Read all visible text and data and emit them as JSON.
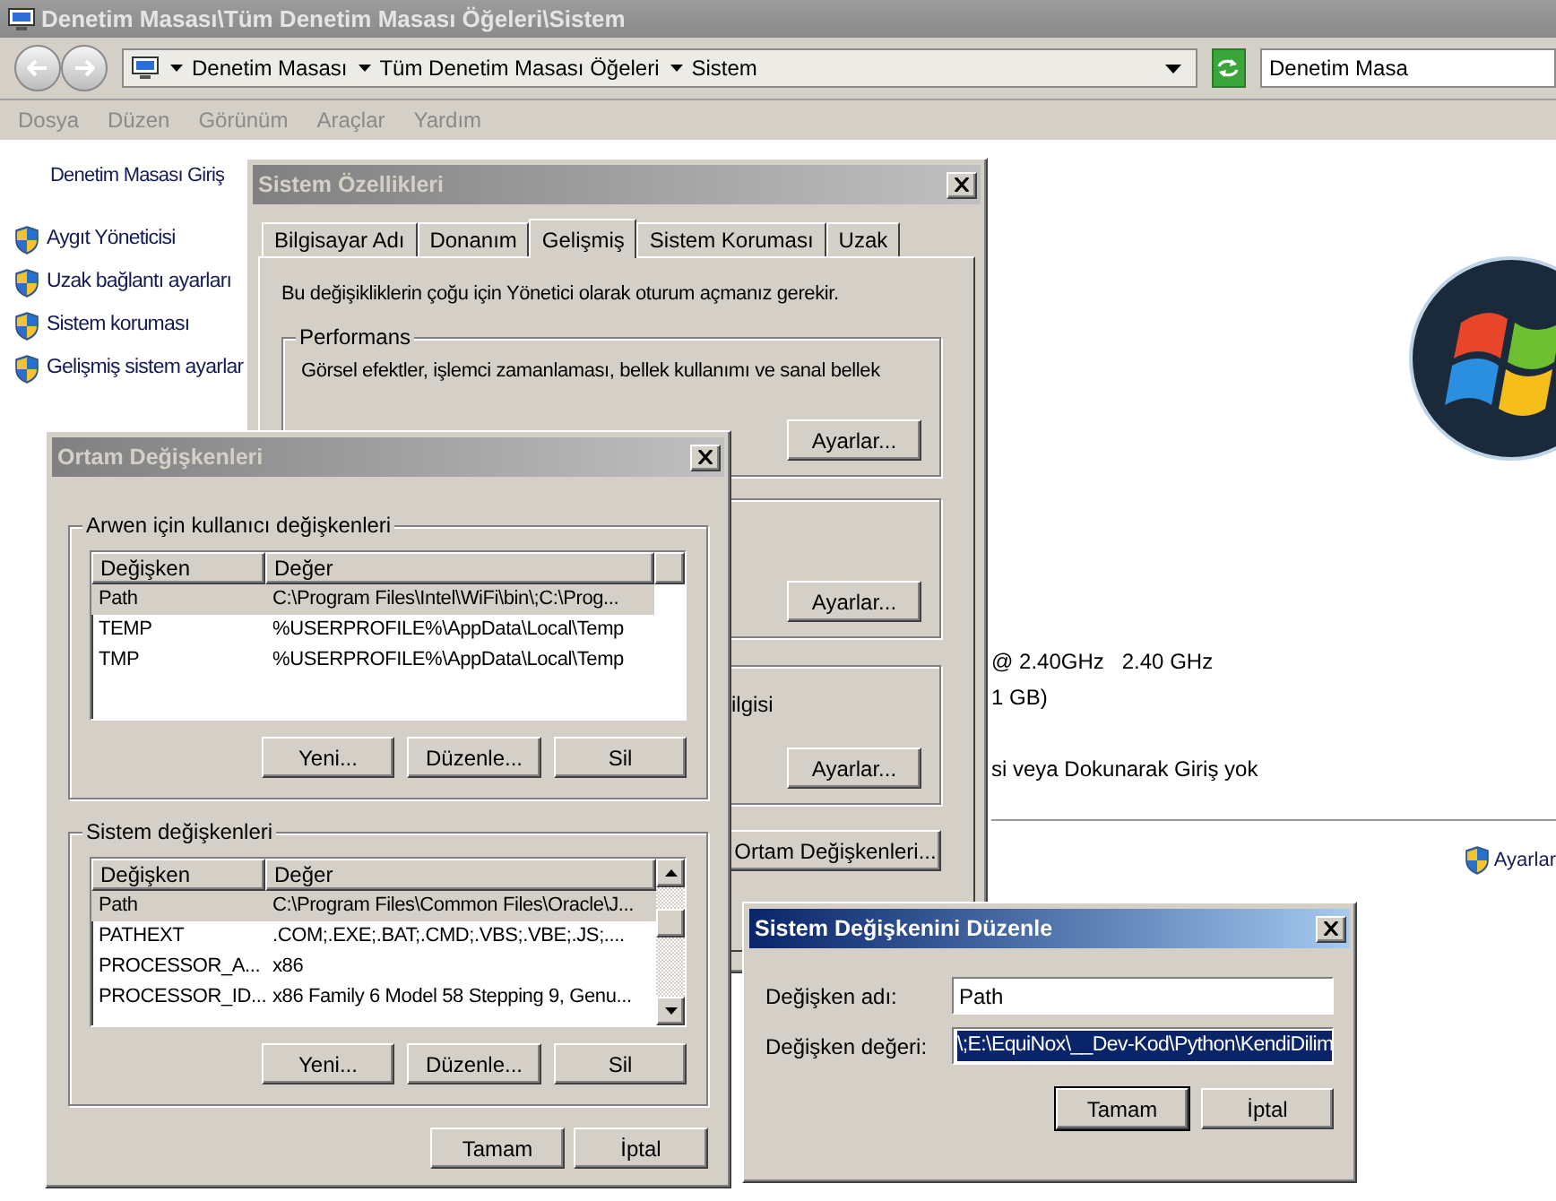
{
  "explorer": {
    "title": "Denetim Masası\\Tüm Denetim Masası Öğeleri\\Sistem",
    "breadcrumb": [
      "Denetim Masası",
      "Tüm Denetim Masası Öğeleri",
      "Sistem"
    ],
    "search": {
      "placeholder": "Denetim Masa"
    },
    "menu": [
      "Dosya",
      "Düzen",
      "Görünüm",
      "Araçlar",
      "Yardım"
    ],
    "sidebar": {
      "home_link": "Denetim Masası Giriş",
      "items": [
        "Aygıt Yöneticisi",
        "Uzak bağlantı ayarları",
        "Sistem koruması",
        "Gelişmiş sistem ayarlar"
      ]
    },
    "info_lines": [
      "@ 2.40GHz   2.40 GHz",
      "1 GB)",
      "si veya Dokunarak Giriş yok"
    ],
    "settings_link": "Ayarlar"
  },
  "system_properties": {
    "title": "Sistem Özellikleri",
    "tabs": [
      {
        "label": "Bilgisayar Adı",
        "selected": false
      },
      {
        "label": "Donanım",
        "selected": false
      },
      {
        "label": "Gelişmiş",
        "selected": true
      },
      {
        "label": "Sistem Koruması",
        "selected": false
      },
      {
        "label": "Uzak",
        "selected": false
      }
    ],
    "admin_note": "Bu değişikliklerin çoğu için Yönetici olarak oturum açmanız gerekir.",
    "performance": {
      "legend": "Performans",
      "text": "Görsel efektler, işlemci zamanlaması, bellek kullanımı ve sanal bellek",
      "button": "Ayarlar..."
    },
    "profiles_button": "Ayarlar...",
    "startup": {
      "text": "ilgisi",
      "button": "Ayarlar..."
    },
    "env_button": "Ortam Değişkenleri..."
  },
  "environment_variables": {
    "title": "Ortam Değişkenleri",
    "user_group": {
      "legend": "Arwen için kullanıcı değişkenleri",
      "columns": [
        "Değişken",
        "Değer"
      ],
      "rows": [
        {
          "name": "Path",
          "value": "C:\\Program Files\\Intel\\WiFi\\bin\\;C:\\Prog...",
          "selected": true
        },
        {
          "name": "TEMP",
          "value": "%USERPROFILE%\\AppData\\Local\\Temp",
          "selected": false
        },
        {
          "name": "TMP",
          "value": "%USERPROFILE%\\AppData\\Local\\Temp",
          "selected": false
        }
      ],
      "buttons": [
        "Yeni...",
        "Düzenle...",
        "Sil"
      ]
    },
    "system_group": {
      "legend": "Sistem değişkenleri",
      "columns": [
        "Değişken",
        "Değer"
      ],
      "rows": [
        {
          "name": "Path",
          "value": "C:\\Program Files\\Common Files\\Oracle\\J...",
          "selected": true
        },
        {
          "name": "PATHEXT",
          "value": ".COM;.EXE;.BAT;.CMD;.VBS;.VBE;.JS;....",
          "selected": false
        },
        {
          "name": "PROCESSOR_A...",
          "value": "x86",
          "selected": false
        },
        {
          "name": "PROCESSOR_ID...",
          "value": "x86 Family 6 Model 58 Stepping 9, Genu...",
          "selected": false
        }
      ],
      "buttons": [
        "Yeni...",
        "Düzenle...",
        "Sil"
      ]
    },
    "buttons": [
      "Tamam",
      "İptal"
    ]
  },
  "edit_dialog": {
    "title": "Sistem Değişkenini Düzenle",
    "name_label": "Değişken adı:",
    "name_value": "Path",
    "value_label": "Değişken değeri:",
    "value_value": "\\;E:\\EquiNox\\__Dev-Kod\\Python\\KendiDilim",
    "value_selected": true,
    "buttons": [
      {
        "label": "Tamam",
        "default": true
      },
      {
        "label": "İptal",
        "default": false
      }
    ]
  }
}
